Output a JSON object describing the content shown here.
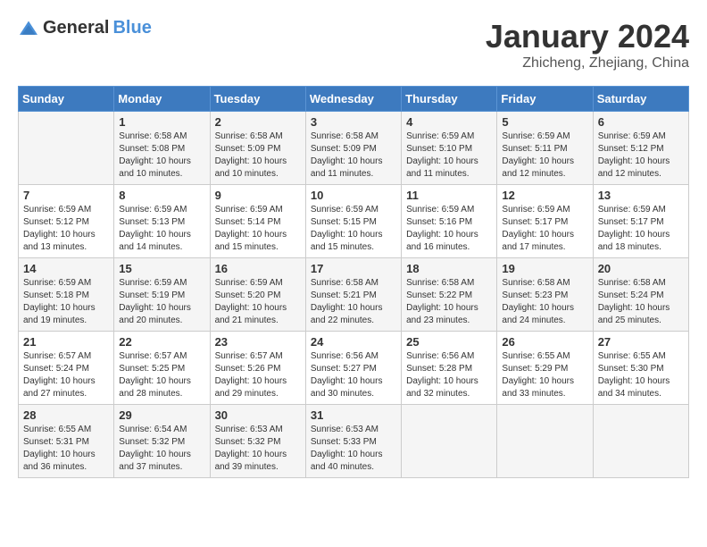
{
  "logo": {
    "general": "General",
    "blue": "Blue"
  },
  "header": {
    "month": "January 2024",
    "location": "Zhicheng, Zhejiang, China"
  },
  "days_of_week": [
    "Sunday",
    "Monday",
    "Tuesday",
    "Wednesday",
    "Thursday",
    "Friday",
    "Saturday"
  ],
  "weeks": [
    [
      {
        "day": "",
        "sunrise": "",
        "sunset": "",
        "daylight": ""
      },
      {
        "day": "1",
        "sunrise": "Sunrise: 6:58 AM",
        "sunset": "Sunset: 5:08 PM",
        "daylight": "Daylight: 10 hours and 10 minutes."
      },
      {
        "day": "2",
        "sunrise": "Sunrise: 6:58 AM",
        "sunset": "Sunset: 5:09 PM",
        "daylight": "Daylight: 10 hours and 10 minutes."
      },
      {
        "day": "3",
        "sunrise": "Sunrise: 6:58 AM",
        "sunset": "Sunset: 5:09 PM",
        "daylight": "Daylight: 10 hours and 11 minutes."
      },
      {
        "day": "4",
        "sunrise": "Sunrise: 6:59 AM",
        "sunset": "Sunset: 5:10 PM",
        "daylight": "Daylight: 10 hours and 11 minutes."
      },
      {
        "day": "5",
        "sunrise": "Sunrise: 6:59 AM",
        "sunset": "Sunset: 5:11 PM",
        "daylight": "Daylight: 10 hours and 12 minutes."
      },
      {
        "day": "6",
        "sunrise": "Sunrise: 6:59 AM",
        "sunset": "Sunset: 5:12 PM",
        "daylight": "Daylight: 10 hours and 12 minutes."
      }
    ],
    [
      {
        "day": "7",
        "sunrise": "Sunrise: 6:59 AM",
        "sunset": "Sunset: 5:12 PM",
        "daylight": "Daylight: 10 hours and 13 minutes."
      },
      {
        "day": "8",
        "sunrise": "Sunrise: 6:59 AM",
        "sunset": "Sunset: 5:13 PM",
        "daylight": "Daylight: 10 hours and 14 minutes."
      },
      {
        "day": "9",
        "sunrise": "Sunrise: 6:59 AM",
        "sunset": "Sunset: 5:14 PM",
        "daylight": "Daylight: 10 hours and 15 minutes."
      },
      {
        "day": "10",
        "sunrise": "Sunrise: 6:59 AM",
        "sunset": "Sunset: 5:15 PM",
        "daylight": "Daylight: 10 hours and 15 minutes."
      },
      {
        "day": "11",
        "sunrise": "Sunrise: 6:59 AM",
        "sunset": "Sunset: 5:16 PM",
        "daylight": "Daylight: 10 hours and 16 minutes."
      },
      {
        "day": "12",
        "sunrise": "Sunrise: 6:59 AM",
        "sunset": "Sunset: 5:17 PM",
        "daylight": "Daylight: 10 hours and 17 minutes."
      },
      {
        "day": "13",
        "sunrise": "Sunrise: 6:59 AM",
        "sunset": "Sunset: 5:17 PM",
        "daylight": "Daylight: 10 hours and 18 minutes."
      }
    ],
    [
      {
        "day": "14",
        "sunrise": "Sunrise: 6:59 AM",
        "sunset": "Sunset: 5:18 PM",
        "daylight": "Daylight: 10 hours and 19 minutes."
      },
      {
        "day": "15",
        "sunrise": "Sunrise: 6:59 AM",
        "sunset": "Sunset: 5:19 PM",
        "daylight": "Daylight: 10 hours and 20 minutes."
      },
      {
        "day": "16",
        "sunrise": "Sunrise: 6:59 AM",
        "sunset": "Sunset: 5:20 PM",
        "daylight": "Daylight: 10 hours and 21 minutes."
      },
      {
        "day": "17",
        "sunrise": "Sunrise: 6:58 AM",
        "sunset": "Sunset: 5:21 PM",
        "daylight": "Daylight: 10 hours and 22 minutes."
      },
      {
        "day": "18",
        "sunrise": "Sunrise: 6:58 AM",
        "sunset": "Sunset: 5:22 PM",
        "daylight": "Daylight: 10 hours and 23 minutes."
      },
      {
        "day": "19",
        "sunrise": "Sunrise: 6:58 AM",
        "sunset": "Sunset: 5:23 PM",
        "daylight": "Daylight: 10 hours and 24 minutes."
      },
      {
        "day": "20",
        "sunrise": "Sunrise: 6:58 AM",
        "sunset": "Sunset: 5:24 PM",
        "daylight": "Daylight: 10 hours and 25 minutes."
      }
    ],
    [
      {
        "day": "21",
        "sunrise": "Sunrise: 6:57 AM",
        "sunset": "Sunset: 5:24 PM",
        "daylight": "Daylight: 10 hours and 27 minutes."
      },
      {
        "day": "22",
        "sunrise": "Sunrise: 6:57 AM",
        "sunset": "Sunset: 5:25 PM",
        "daylight": "Daylight: 10 hours and 28 minutes."
      },
      {
        "day": "23",
        "sunrise": "Sunrise: 6:57 AM",
        "sunset": "Sunset: 5:26 PM",
        "daylight": "Daylight: 10 hours and 29 minutes."
      },
      {
        "day": "24",
        "sunrise": "Sunrise: 6:56 AM",
        "sunset": "Sunset: 5:27 PM",
        "daylight": "Daylight: 10 hours and 30 minutes."
      },
      {
        "day": "25",
        "sunrise": "Sunrise: 6:56 AM",
        "sunset": "Sunset: 5:28 PM",
        "daylight": "Daylight: 10 hours and 32 minutes."
      },
      {
        "day": "26",
        "sunrise": "Sunrise: 6:55 AM",
        "sunset": "Sunset: 5:29 PM",
        "daylight": "Daylight: 10 hours and 33 minutes."
      },
      {
        "day": "27",
        "sunrise": "Sunrise: 6:55 AM",
        "sunset": "Sunset: 5:30 PM",
        "daylight": "Daylight: 10 hours and 34 minutes."
      }
    ],
    [
      {
        "day": "28",
        "sunrise": "Sunrise: 6:55 AM",
        "sunset": "Sunset: 5:31 PM",
        "daylight": "Daylight: 10 hours and 36 minutes."
      },
      {
        "day": "29",
        "sunrise": "Sunrise: 6:54 AM",
        "sunset": "Sunset: 5:32 PM",
        "daylight": "Daylight: 10 hours and 37 minutes."
      },
      {
        "day": "30",
        "sunrise": "Sunrise: 6:53 AM",
        "sunset": "Sunset: 5:32 PM",
        "daylight": "Daylight: 10 hours and 39 minutes."
      },
      {
        "day": "31",
        "sunrise": "Sunrise: 6:53 AM",
        "sunset": "Sunset: 5:33 PM",
        "daylight": "Daylight: 10 hours and 40 minutes."
      },
      {
        "day": "",
        "sunrise": "",
        "sunset": "",
        "daylight": ""
      },
      {
        "day": "",
        "sunrise": "",
        "sunset": "",
        "daylight": ""
      },
      {
        "day": "",
        "sunrise": "",
        "sunset": "",
        "daylight": ""
      }
    ]
  ]
}
